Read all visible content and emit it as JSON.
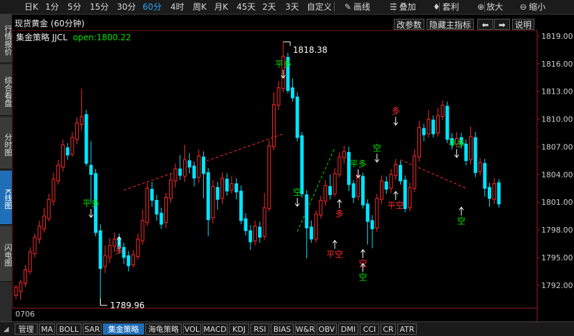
{
  "toolbar": {
    "items": [
      {
        "label": "日K",
        "active": false
      },
      {
        "label": "1分",
        "active": false
      },
      {
        "label": "5分",
        "active": false
      },
      {
        "label": "15分",
        "active": false
      },
      {
        "label": "30分",
        "active": false
      },
      {
        "label": "60分",
        "active": true
      },
      {
        "label": "4时",
        "active": false
      },
      {
        "label": "周K",
        "active": false
      },
      {
        "label": "月K",
        "active": false
      },
      {
        "label": "45天",
        "active": false
      },
      {
        "label": "2天",
        "active": false
      },
      {
        "label": "3天",
        "active": false
      },
      {
        "label": "自定义",
        "active": false
      }
    ],
    "tools": [
      {
        "label": "画线",
        "icon": "pencil-icon",
        "glyph": "✎"
      },
      {
        "label": "叠加",
        "icon": "stack-icon",
        "glyph": "☰"
      },
      {
        "label": "套利",
        "icon": "moneybag-icon",
        "glyph": "♦"
      },
      {
        "label": "放大",
        "icon": "zoom-in-icon",
        "glyph": "⊕"
      },
      {
        "label": "缩小",
        "icon": "zoom-out-icon",
        "glyph": "⊖"
      }
    ]
  },
  "left_tabs": [
    {
      "label": "行情报价",
      "active": false
    },
    {
      "label": "综合看盘",
      "active": false
    },
    {
      "label": "分时图",
      "active": false
    },
    {
      "label": "K线图",
      "active": true
    },
    {
      "label": "闪电图",
      "active": false
    }
  ],
  "chart_header": {
    "title": "现货黄金 (60分钟)",
    "strategy": "集金策略",
    "code": "JJCL",
    "open_text": "open:1800.22"
  },
  "chart_controls": {
    "modify_params": "改参数",
    "hide_indicator": "隐藏主指标",
    "prev_glyph": "⬅",
    "next_glyph": "➡",
    "help": "说明"
  },
  "bottom_tabs": {
    "left_glyph": "◢",
    "items": [
      {
        "label": "管理",
        "active": false
      },
      {
        "label": "MA",
        "active": false
      },
      {
        "label": "BOLL",
        "active": false
      },
      {
        "label": "SAR",
        "active": false
      },
      {
        "label": "集金策略",
        "active": true
      },
      {
        "label": "海龟策略",
        "active": false
      },
      {
        "label": "VOL",
        "active": false
      },
      {
        "label": "MACD",
        "active": false
      },
      {
        "label": "KDJ",
        "active": false
      },
      {
        "label": "RSI",
        "active": false
      },
      {
        "label": "BIAS",
        "active": false
      },
      {
        "label": "W&R",
        "active": false
      },
      {
        "label": "OBV",
        "active": false
      },
      {
        "label": "DMI",
        "active": false
      },
      {
        "label": "CCI",
        "active": false
      },
      {
        "label": "CR",
        "active": false
      },
      {
        "label": "ATR",
        "active": false
      }
    ]
  },
  "date_label": "0706",
  "colors": {
    "up": "#ff2a2a",
    "down": "#00e5ff",
    "buy_signal": "#00e000",
    "sell_signal": "#ff2a2a",
    "arrow": "#ffffff",
    "trend_up": "#00e000",
    "trend_down": "#ff2a2a",
    "active_tab": "#1f6fb8"
  },
  "chart_data": {
    "type": "candlestick",
    "y_axis_ticks": [
      1819.0,
      1816.0,
      1813.0,
      1810.0,
      1807.0,
      1804.0,
      1801.0,
      1798.0,
      1795.0,
      1792.0
    ],
    "y_axis_tick_labels": [
      "1819.00",
      "1816.00",
      "1813.00",
      "1810.00",
      "1807.00",
      "1804.00",
      "1801.00",
      "1798.00",
      "1795.00",
      "1792.00"
    ],
    "ylim": [
      1789.5,
      1819.6
    ],
    "high_label": "1818.38",
    "low_label": "1789.96",
    "extremes": {
      "high_index": 57,
      "high": 1818.38,
      "low_index": 18,
      "low": 1789.96
    },
    "candles": [
      [
        1790.9,
        1791.8,
        1790.5,
        1792.0
      ],
      [
        1791.3,
        1792.3,
        1790.4,
        1792.6
      ],
      [
        1792.2,
        1793.7,
        1791.8,
        1794.2
      ],
      [
        1793.5,
        1795.6,
        1793.2,
        1796.1
      ],
      [
        1795.4,
        1797.2,
        1795.0,
        1797.6
      ],
      [
        1797.0,
        1798.4,
        1796.5,
        1799.0
      ],
      [
        1798.1,
        1799.5,
        1797.7,
        1800.4
      ],
      [
        1799.2,
        1801.3,
        1798.9,
        1801.9
      ],
      [
        1801.1,
        1803.5,
        1800.6,
        1804.2
      ],
      [
        1803.3,
        1805.0,
        1802.9,
        1805.6
      ],
      [
        1804.8,
        1807.2,
        1804.3,
        1807.8
      ],
      [
        1806.9,
        1806.1,
        1805.6,
        1807.4
      ],
      [
        1806.2,
        1808.0,
        1805.9,
        1808.6
      ],
      [
        1807.8,
        1809.6,
        1807.3,
        1810.2
      ],
      [
        1809.4,
        1810.3,
        1808.8,
        1813.3
      ],
      [
        1810.5,
        1805.2,
        1804.9,
        1811.0
      ],
      [
        1805.0,
        1804.0,
        1800.9,
        1807.6
      ],
      [
        1804.1,
        1797.7,
        1797.3,
        1804.6
      ],
      [
        1797.9,
        1793.8,
        1789.96,
        1798.6
      ],
      [
        1794.0,
        1795.2,
        1793.3,
        1796.3
      ],
      [
        1795.0,
        1796.3,
        1794.4,
        1797.1
      ],
      [
        1796.2,
        1797.0,
        1795.6,
        1797.7
      ],
      [
        1797.1,
        1796.0,
        1795.5,
        1797.6
      ],
      [
        1796.1,
        1795.0,
        1794.3,
        1796.6
      ],
      [
        1795.2,
        1794.1,
        1793.5,
        1795.7
      ],
      [
        1794.2,
        1795.3,
        1793.9,
        1795.8
      ],
      [
        1795.1,
        1797.0,
        1794.8,
        1797.6
      ],
      [
        1796.8,
        1799.0,
        1796.4,
        1800.2
      ],
      [
        1798.8,
        1802.5,
        1798.4,
        1803.1
      ],
      [
        1802.4,
        1801.2,
        1800.5,
        1803.2
      ],
      [
        1801.2,
        1799.7,
        1799.0,
        1801.8
      ],
      [
        1799.8,
        1798.6,
        1798.1,
        1800.4
      ],
      [
        1798.8,
        1801.5,
        1798.2,
        1802.0
      ],
      [
        1801.4,
        1803.4,
        1800.9,
        1804.1
      ],
      [
        1803.3,
        1804.6,
        1802.6,
        1805.2
      ],
      [
        1804.6,
        1803.9,
        1803.4,
        1806.1
      ],
      [
        1803.8,
        1805.6,
        1803.2,
        1807.2
      ],
      [
        1805.5,
        1804.8,
        1804.1,
        1806.3
      ],
      [
        1804.9,
        1803.6,
        1802.7,
        1805.4
      ],
      [
        1803.7,
        1806.0,
        1803.1,
        1806.7
      ],
      [
        1805.9,
        1804.1,
        1801.4,
        1806.5
      ],
      [
        1804.2,
        1799.1,
        1797.3,
        1804.7
      ],
      [
        1799.3,
        1802.7,
        1798.7,
        1803.4
      ],
      [
        1802.6,
        1801.3,
        1800.2,
        1803.2
      ],
      [
        1801.4,
        1803.6,
        1800.8,
        1804.2
      ],
      [
        1803.5,
        1802.2,
        1801.7,
        1804.1
      ],
      [
        1802.3,
        1803.0,
        1801.9,
        1803.8
      ],
      [
        1803.0,
        1802.1,
        1801.3,
        1803.6
      ],
      [
        1802.2,
        1799.0,
        1798.6,
        1802.8
      ],
      [
        1799.2,
        1797.9,
        1797.4,
        1799.8
      ],
      [
        1797.9,
        1796.7,
        1795.8,
        1798.5
      ],
      [
        1796.8,
        1798.4,
        1796.3,
        1799.0
      ],
      [
        1798.3,
        1797.2,
        1796.6,
        1798.9
      ],
      [
        1797.3,
        1800.4,
        1796.9,
        1802.0
      ],
      [
        1800.3,
        1807.1,
        1800.0,
        1807.7
      ],
      [
        1807.0,
        1811.6,
        1806.6,
        1812.9
      ],
      [
        1811.5,
        1813.4,
        1811.0,
        1814.1
      ],
      [
        1813.3,
        1816.8,
        1812.9,
        1818.38
      ],
      [
        1816.7,
        1813.1,
        1812.8,
        1817.2
      ],
      [
        1813.4,
        1812.3,
        1811.9,
        1814.4
      ],
      [
        1812.4,
        1808.0,
        1807.6,
        1812.9
      ],
      [
        1808.2,
        1801.9,
        1801.5,
        1808.6
      ],
      [
        1801.8,
        1798.2,
        1794.9,
        1802.3
      ],
      [
        1798.3,
        1797.0,
        1796.6,
        1799.0
      ],
      [
        1797.0,
        1799.7,
        1796.6,
        1800.1
      ],
      [
        1799.6,
        1801.2,
        1799.2,
        1801.7
      ],
      [
        1801.1,
        1802.8,
        1800.6,
        1803.4
      ],
      [
        1802.7,
        1801.8,
        1801.3,
        1804.0
      ],
      [
        1801.9,
        1804.1,
        1801.6,
        1804.7
      ],
      [
        1804.0,
        1805.9,
        1803.7,
        1806.4
      ],
      [
        1805.8,
        1806.5,
        1805.2,
        1807.1
      ],
      [
        1806.4,
        1802.9,
        1802.2,
        1807.0
      ],
      [
        1803.0,
        1801.5,
        1800.9,
        1803.4
      ],
      [
        1801.6,
        1803.9,
        1801.2,
        1804.5
      ],
      [
        1803.8,
        1800.7,
        1800.3,
        1804.2
      ],
      [
        1800.8,
        1798.9,
        1796.4,
        1801.3
      ],
      [
        1799.0,
        1798.1,
        1796.0,
        1799.6
      ],
      [
        1798.2,
        1801.4,
        1797.8,
        1801.9
      ],
      [
        1801.3,
        1803.3,
        1800.8,
        1803.9
      ],
      [
        1803.2,
        1802.4,
        1801.9,
        1803.8
      ],
      [
        1802.5,
        1804.0,
        1802.0,
        1804.6
      ],
      [
        1803.9,
        1805.1,
        1803.4,
        1805.7
      ],
      [
        1805.0,
        1803.3,
        1802.9,
        1805.5
      ],
      [
        1803.4,
        1800.3,
        1799.9,
        1803.9
      ],
      [
        1800.4,
        1802.6,
        1800.0,
        1803.1
      ],
      [
        1802.5,
        1806.0,
        1802.1,
        1806.7
      ],
      [
        1805.9,
        1809.1,
        1805.4,
        1809.8
      ],
      [
        1809.0,
        1808.3,
        1807.6,
        1809.5
      ],
      [
        1808.4,
        1810.0,
        1808.0,
        1811.0
      ],
      [
        1809.9,
        1808.4,
        1808.0,
        1810.4
      ],
      [
        1808.5,
        1810.4,
        1808.1,
        1811.2
      ],
      [
        1810.3,
        1811.5,
        1809.9,
        1812.0
      ],
      [
        1811.4,
        1807.8,
        1807.4,
        1811.9
      ],
      [
        1807.9,
        1807.2,
        1806.7,
        1808.5
      ],
      [
        1807.3,
        1807.9,
        1806.9,
        1808.6
      ],
      [
        1808.0,
        1807.3,
        1806.8,
        1808.5
      ],
      [
        1807.3,
        1805.5,
        1805.0,
        1807.8
      ],
      [
        1805.6,
        1808.1,
        1805.1,
        1809.2
      ],
      [
        1808.0,
        1804.2,
        1803.7,
        1808.6
      ],
      [
        1804.3,
        1805.3,
        1803.9,
        1805.8
      ],
      [
        1805.2,
        1802.5,
        1801.6,
        1805.7
      ],
      [
        1802.6,
        1801.4,
        1800.5,
        1803.1
      ],
      [
        1801.3,
        1803.0,
        1800.8,
        1803.6
      ],
      [
        1803.1,
        1800.8,
        1800.4,
        1803.5
      ]
    ],
    "signals": [
      {
        "label": "平多",
        "i": 16,
        "price": 1800.1,
        "side": "above",
        "color": "buy"
      },
      {
        "label": "多",
        "i": 22,
        "price": 1797.1,
        "side": "below",
        "color": "sell"
      },
      {
        "label": "平多",
        "i": 57,
        "price": 1815.2,
        "side": "above",
        "color": "buy"
      },
      {
        "label": "空",
        "i": 60,
        "price": 1801.3,
        "side": "above",
        "color": "buy"
      },
      {
        "label": "多",
        "i": 69,
        "price": 1801.1,
        "side": "below",
        "color": "sell"
      },
      {
        "label": "平空",
        "i": 68,
        "price": 1796.7,
        "side": "below",
        "color": "sell"
      },
      {
        "label": "平多",
        "i": 73,
        "price": 1804.4,
        "side": "above",
        "color": "buy"
      },
      {
        "label": "空",
        "i": 74,
        "price": 1795.7,
        "side": "below",
        "color": "sell"
      },
      {
        "label": "空",
        "i": 74,
        "price": 1794.2,
        "side": "below",
        "color": "buy"
      },
      {
        "label": "空",
        "i": 77,
        "price": 1806.1,
        "side": "above",
        "color": "buy"
      },
      {
        "label": "多",
        "i": 81,
        "price": 1810.1,
        "side": "above",
        "color": "sell"
      },
      {
        "label": "平空",
        "i": 81,
        "price": 1802.0,
        "side": "below",
        "color": "sell"
      },
      {
        "label": "平多",
        "i": 94,
        "price": 1806.6,
        "side": "above",
        "color": "buy"
      },
      {
        "label": "空",
        "i": 95,
        "price": 1800.3,
        "side": "below",
        "color": "buy"
      }
    ],
    "trend_lines": [
      {
        "from_i": 23,
        "from_p": 1802.3,
        "to_i": 57,
        "to_p": 1808.4,
        "color": "trend_down"
      },
      {
        "from_i": 60,
        "from_p": 1797.8,
        "to_i": 68,
        "to_p": 1806.9,
        "color": "trend_up"
      },
      {
        "from_i": 82,
        "from_p": 1805.6,
        "to_i": 96,
        "to_p": 1802.5,
        "color": "trend_down"
      }
    ]
  }
}
